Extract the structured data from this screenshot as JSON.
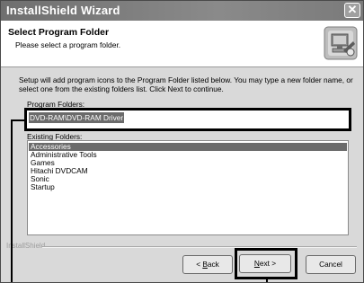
{
  "window": {
    "title": "InstallShield Wizard",
    "close_glyph": "✕"
  },
  "header": {
    "title": "Select Program Folder",
    "subtitle": "Please select a program folder.",
    "icon": "installer-computer-icon"
  },
  "instructions": "Setup will add program icons to the Program Folder listed below.  You may type a new folder name, or select one from the existing folders list.  Click Next to continue.",
  "program_folder": {
    "label_prefix": "P",
    "label_rest": "rogram Folders:",
    "value": "DVD-RAM\\DVD-RAM Driver"
  },
  "existing_folders": {
    "label_prefix": "E",
    "label_rest": "xisting Folders:",
    "items": [
      "Accessories",
      "Administrative Tools",
      "Games",
      "Hitachi DVDCAM",
      "Sonic",
      "Startup"
    ],
    "selected_index": 0
  },
  "brand": "InstallShield",
  "buttons": {
    "back_prefix": "< ",
    "back_accel": "B",
    "back_rest": "ack",
    "next_accel": "N",
    "next_rest": "ext >",
    "cancel": "Cancel"
  }
}
